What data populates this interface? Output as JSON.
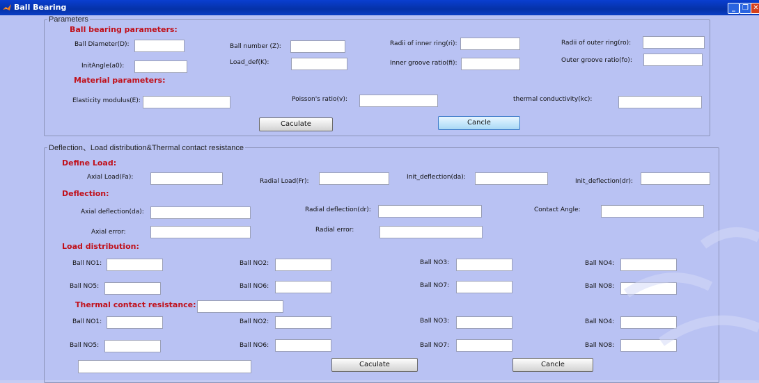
{
  "window": {
    "title": "Ball Bearing",
    "icons": [
      "matlab-icon",
      "minimize-icon",
      "maximize-icon",
      "close-icon"
    ]
  },
  "parameters": {
    "legend": "Parameters",
    "ball_section": "Ball bearing parameters:",
    "ball_diameter": "Ball Diameter(D):",
    "ball_number": "Ball number (Z):",
    "radii_inner": "Radii of inner ring(ri):",
    "radii_outer": "Radii of outer ring(ro):",
    "init_angle": "InitAngle(a0):",
    "load_def": "Load_def(K):",
    "inner_groove": "Inner groove ratio(fi):",
    "outer_groove": "Outer groove ratio(fo):",
    "material_section": "Material parameters:",
    "elasticity": "Elasticity modulus(E):",
    "poisson": "Poisson's ratio(v):",
    "thermal_cond": "thermal conductivity(kc):",
    "calculate_button": "Caculate",
    "cancel_button": "Cancle"
  },
  "deflection": {
    "legend": "Deflection、Load distribution&Thermal contact resistance",
    "define_load_section": "Define Load:",
    "axial_load": "Axial Load(Fa):",
    "radial_load": "Radial Load(Fr):",
    "init_deflection_da": "Init_deflection(da):",
    "init_deflection_dr": "Init_deflection(dr):",
    "deflection_section": "Deflection:",
    "axial_deflection": "Axial deflection(da):",
    "radial_deflection": "Radial deflection(dr):",
    "contact_angle": "Contact Angle:",
    "axial_error": "Axial error:",
    "radial_error": "Radial error:",
    "load_distribution_section": "Load distribution:",
    "ball_labels": [
      "Ball NO1:",
      "Ball NO2:",
      "Ball NO3:",
      "Ball NO4:",
      "Ball NO5:",
      "Ball NO6:",
      "Ball NO7:",
      "Ball NO8:"
    ],
    "thermal_section": "Thermal  contact resistance:",
    "calculate_button": "Caculate",
    "cancel_button": "Cancle"
  },
  "colors": {
    "background": "#b9c2f3",
    "title_bar": "#0531a8",
    "section_label": "#c0101a",
    "field": "#ffffff"
  }
}
